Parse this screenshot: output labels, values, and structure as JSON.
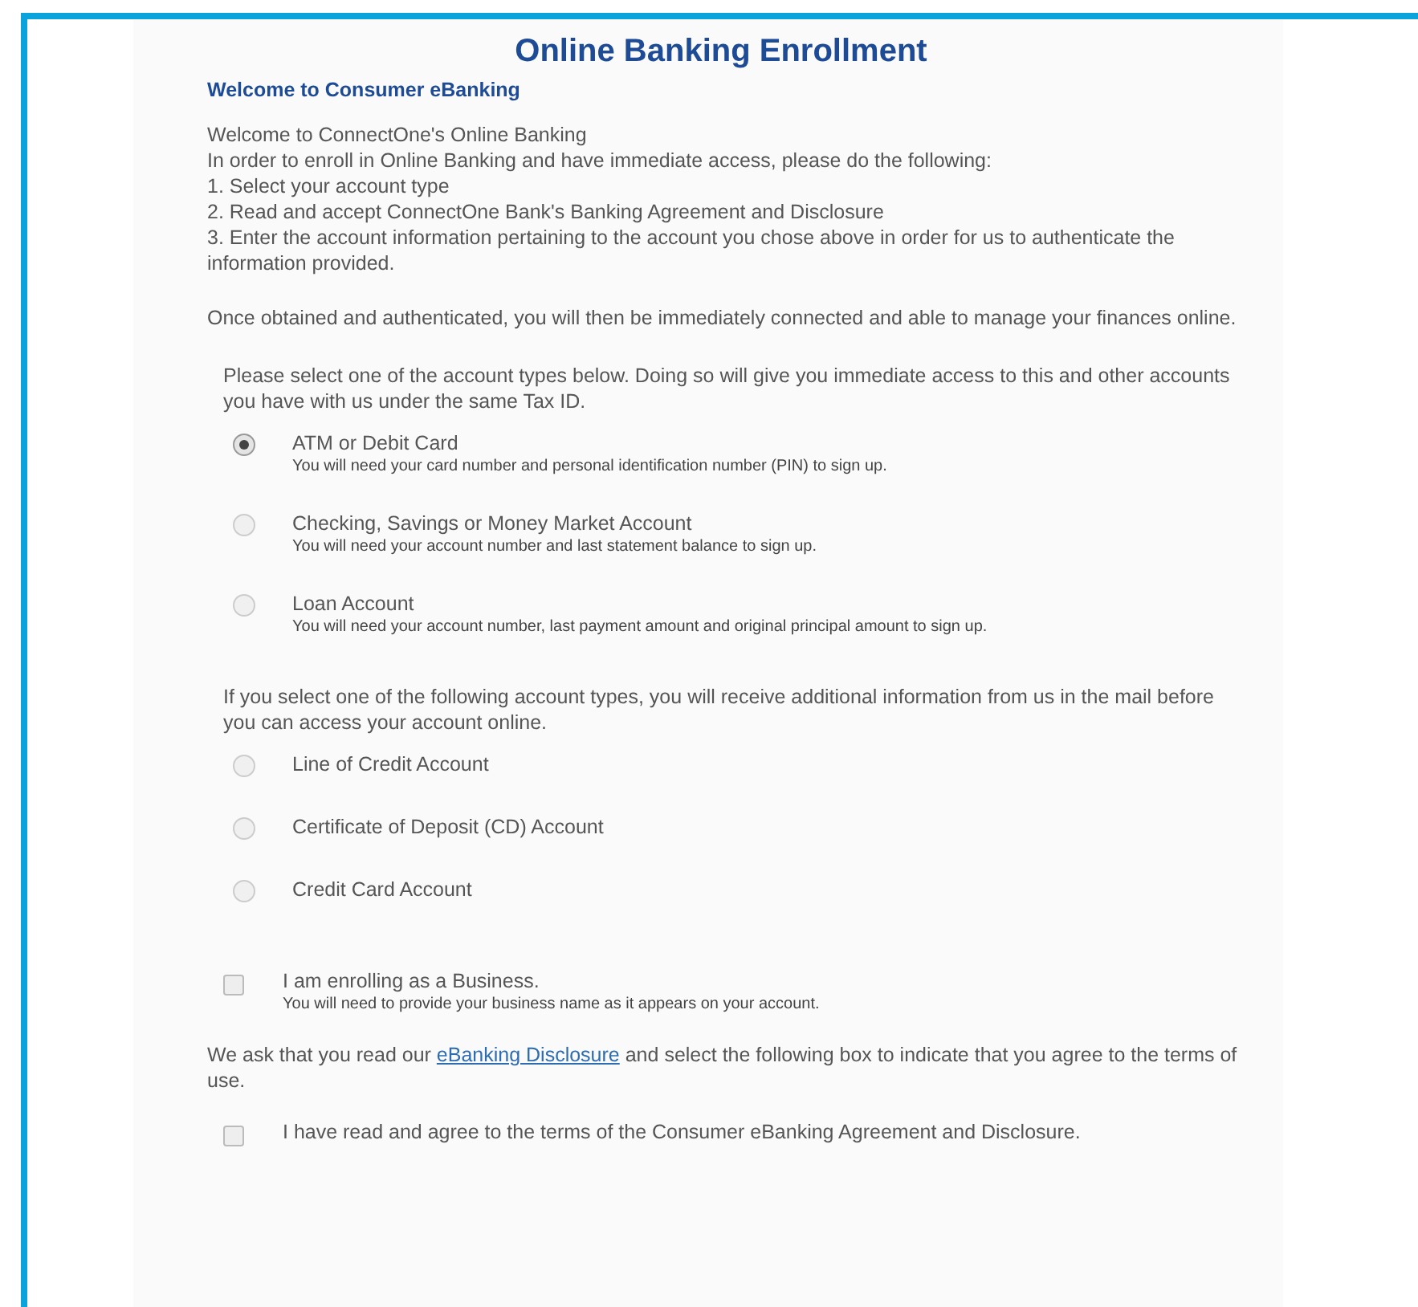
{
  "title": "Online Banking Enrollment",
  "subtitle": "Welcome to Consumer eBanking",
  "intro_lines": [
    "Welcome to ConnectOne's Online Banking",
    "In order to enroll in Online Banking and have immediate access, please do the following:",
    "1. Select your account type",
    "2. Read and accept ConnectOne Bank's Banking Agreement and Disclosure",
    "3. Enter the account information pertaining to the account you chose above in order for us to authenticate the information provided."
  ],
  "outro": "Once obtained and authenticated, you will then be immediately connected and able to manage your finances online.",
  "account_groups": [
    {
      "note": "Please select one of the account types below. Doing so will give you immediate access to this and other accounts you have with us under the same Tax ID.",
      "options": [
        {
          "label": "ATM or Debit Card",
          "hint": "You will need your card number and personal identification number (PIN) to sign up.",
          "selected": true
        },
        {
          "label": "Checking, Savings or Money Market Account",
          "hint": "You will need your account number and last statement balance to sign up.",
          "selected": false
        },
        {
          "label": "Loan Account",
          "hint": "You will need your account number, last payment amount and original principal amount to sign up.",
          "selected": false
        }
      ]
    },
    {
      "note": "If you select one of the following account types, you will receive additional information from us in the mail before you can access your account online.",
      "options": [
        {
          "label": "Line of Credit Account",
          "selected": false
        },
        {
          "label": "Certificate of Deposit (CD) Account",
          "selected": false
        },
        {
          "label": "Credit Card Account",
          "selected": false
        }
      ]
    }
  ],
  "business": {
    "label": "I am enrolling as a Business.",
    "hint": "You will need to provide your business name as it appears on your account.",
    "checked": false
  },
  "disclosure": {
    "before": "We ask that you read our",
    "link": "eBanking Disclosure",
    "after": "and select the following box to indicate that you agree to the terms of use."
  },
  "agree": {
    "label": "I have read and agree to the terms of the Consumer eBanking Agreement and Disclosure.",
    "checked": false
  }
}
